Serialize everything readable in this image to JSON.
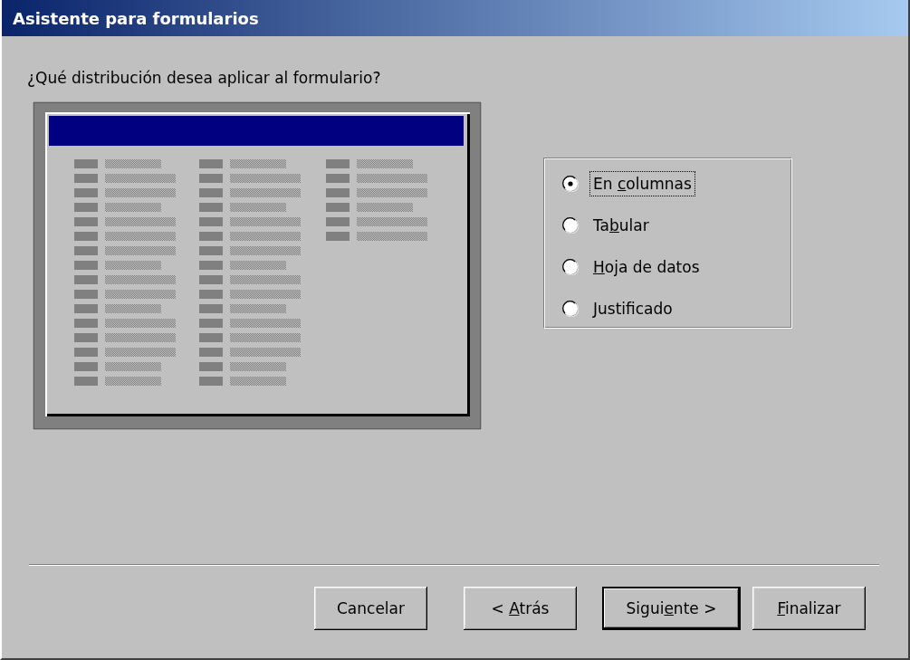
{
  "window": {
    "title": "Asistente para formularios"
  },
  "prompt": "¿Qué distribución desea aplicar al formulario?",
  "layouts": [
    {
      "label": {
        "before": "En ",
        "key": "c",
        "after": "olumnas"
      },
      "selected": true,
      "focused": true
    },
    {
      "label": {
        "before": "Ta",
        "key": "b",
        "after": "ular"
      },
      "selected": false,
      "focused": false
    },
    {
      "label": {
        "key": "H",
        "after": "oja de datos"
      },
      "selected": false,
      "focused": false
    },
    {
      "label": {
        "key": "J",
        "after": "ustificado"
      },
      "selected": false,
      "focused": false
    }
  ],
  "buttons": [
    {
      "label": {
        "before": "Cancelar"
      },
      "default": false
    },
    {
      "label": {
        "before": "< ",
        "key": "A",
        "after": "trás"
      },
      "default": false
    },
    {
      "label": {
        "before": "Sigui",
        "key": "e",
        "after": "nte >"
      },
      "default": true
    },
    {
      "label": {
        "key": "F",
        "after": "inalizar"
      },
      "default": false
    }
  ]
}
